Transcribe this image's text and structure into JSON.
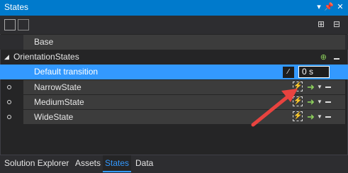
{
  "window": {
    "title": "States"
  },
  "colors": {
    "accent": "#007acc",
    "selected": "#3399ff",
    "annotation": "#e8433f"
  },
  "rows": {
    "base": "Base",
    "group": "OrientationStates",
    "default_transition": {
      "label": "Default transition",
      "duration": "0 s"
    },
    "states": [
      {
        "label": "NarrowState"
      },
      {
        "label": "MediumState"
      },
      {
        "label": "WideState"
      }
    ]
  },
  "tabs": {
    "solution_explorer": "Solution Explorer",
    "assets": "Assets",
    "states": "States",
    "data": "Data"
  }
}
